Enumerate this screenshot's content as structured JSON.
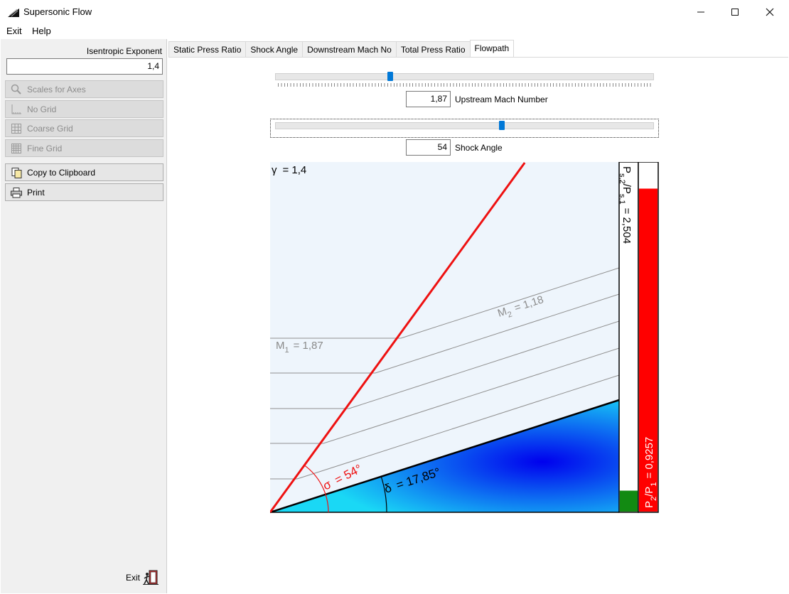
{
  "window": {
    "title": "Supersonic Flow"
  },
  "menu": {
    "exit": "Exit",
    "help": "Help"
  },
  "sidebar": {
    "exponent_label": "Isentropic Exponent",
    "exponent_value": "1,4",
    "buttons": {
      "scales": "Scales for Axes",
      "no_grid": "No Grid",
      "coarse_grid": "Coarse Grid",
      "fine_grid": "Fine Grid",
      "copy": "Copy to Clipboard",
      "print": "Print"
    },
    "exit_label": "Exit"
  },
  "tabs": [
    "Static Press Ratio",
    "Shock Angle",
    "Downstream Mach No",
    "Total Press Ratio",
    "Flowpath"
  ],
  "active_tab": "Flowpath",
  "controls": {
    "mach_value": "1,87",
    "mach_label": "Upstream Mach Number",
    "mach_slider_fraction": 0.3,
    "shock_value": "54",
    "shock_label": "Shock Angle",
    "shock_slider_fraction": 0.6
  },
  "flowpath": {
    "gamma_symbol": "γ",
    "gamma_text": "= 1,4",
    "m1_label": "M",
    "m1_sub": "1",
    "m1_value": "= 1,87",
    "m2_label": "M",
    "m2_sub": "2",
    "m2_value": "= 1,18",
    "shock_angle_deg": 54,
    "shock_symbol": "σ",
    "shock_text": "= 54°",
    "deflection_deg": 17.85,
    "deflection_symbol": "δ",
    "deflection_text": "= 17,85°",
    "static_ratio_label_p": "P",
    "static_ratio_sub1": "s,2",
    "static_ratio_sep": "/P",
    "static_ratio_sub2": "s,1",
    "static_ratio_value": "= 2,504",
    "static_ratio_fill_fraction": 0.06,
    "total_ratio_label_p": "P",
    "total_ratio_sub1": "2",
    "total_ratio_sep": "/P",
    "total_ratio_sub2": "1",
    "total_ratio_value": "= 0,9257",
    "total_ratio_fill_fraction": 0.9257,
    "colors": {
      "shock": "#ee1111",
      "wedge_light": "#1ad8f5",
      "wedge_dark": "#0000ee",
      "flow_bg": "#eef5fc",
      "static_bar": "#128a12",
      "total_bar": "#ff0000"
    }
  }
}
